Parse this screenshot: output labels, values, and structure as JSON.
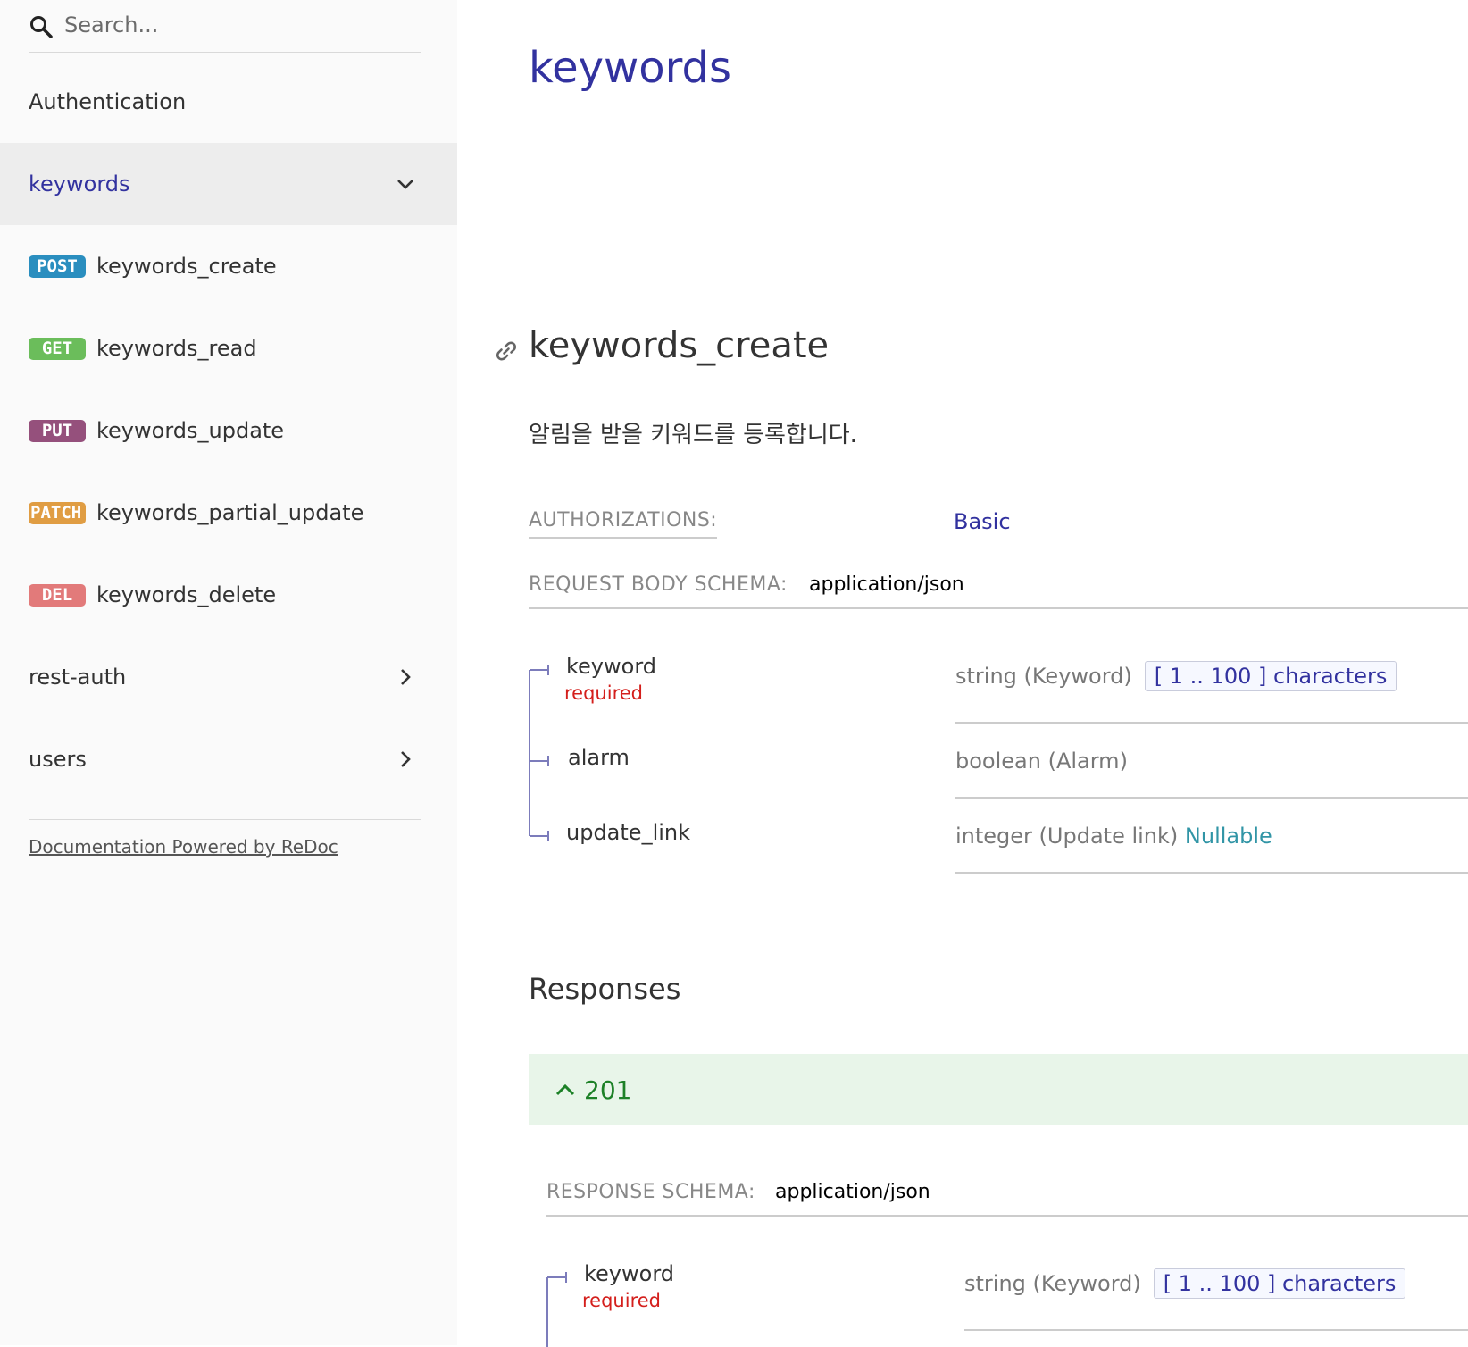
{
  "sidebar": {
    "search_placeholder": "Search...",
    "authentication": "Authentication",
    "active_group": "keywords",
    "operations": [
      {
        "method": "POST",
        "label": "keywords_create"
      },
      {
        "method": "GET",
        "label": "keywords_read"
      },
      {
        "method": "PUT",
        "label": "keywords_update"
      },
      {
        "method": "PATCH",
        "label": "keywords_partial_update"
      },
      {
        "method": "DEL",
        "label": "keywords_delete"
      }
    ],
    "groups": [
      "rest-auth",
      "users"
    ],
    "footer_link": "Documentation Powered by ReDoc"
  },
  "main": {
    "tag_title": "keywords",
    "operation_title": "keywords_create",
    "description": "알림을 받을 키워드를 등록합니다.",
    "authorizations_label": "AUTHORIZATIONS:",
    "authorizations_value": "Basic",
    "request_schema_label": "REQUEST BODY SCHEMA:",
    "request_schema_value": "application/json",
    "request_props": [
      {
        "name": "keyword",
        "required": "required",
        "type": "string (Keyword)",
        "constraint": "[ 1 .. 100 ] characters"
      },
      {
        "name": "alarm",
        "type": "boolean (Alarm)"
      },
      {
        "name": "update_link",
        "type": "integer (Update link)",
        "nullable": "Nullable"
      }
    ],
    "responses_title": "Responses",
    "response_code": "201",
    "response_schema_label": "RESPONSE SCHEMA:",
    "response_schema_value": "application/json",
    "response_props": [
      {
        "name": "keyword",
        "required": "required",
        "type": "string (Keyword)",
        "constraint": "[ 1 .. 100 ] characters"
      }
    ]
  },
  "colors": {
    "accent": "#32329f",
    "post": "#2a8ebf",
    "get": "#6bbd5b",
    "put": "#95507c",
    "patch": "#e09d43",
    "delete": "#e27a7a",
    "required": "#d41f1c",
    "success": "#1d8127"
  }
}
